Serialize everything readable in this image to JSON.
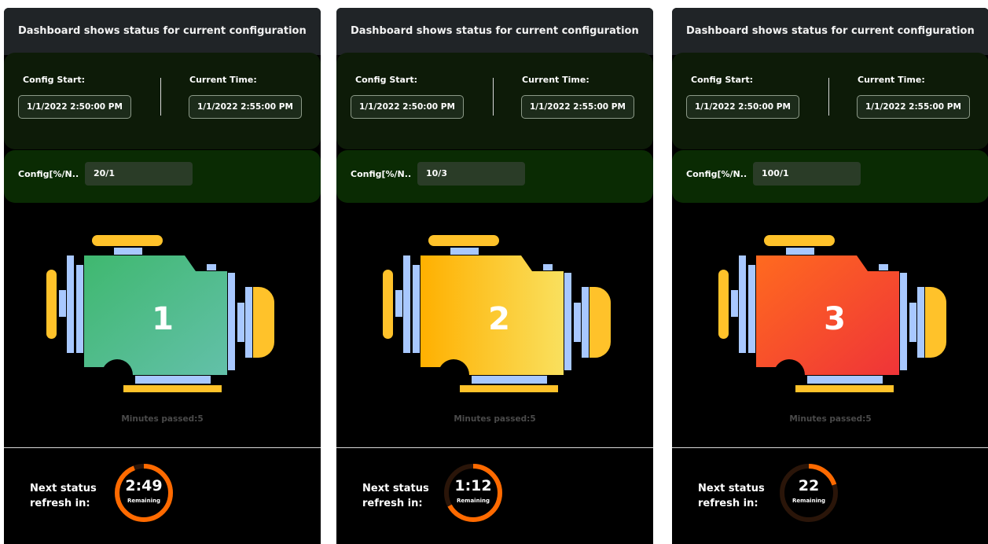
{
  "colors": {
    "accent_orange": "#ff6a00",
    "ring_track": "#2a1509",
    "panel_bg": "#000000",
    "header_bg": "#202427",
    "time_box_bg": "#0d1b08",
    "config_box_bg": "#0a2b03"
  },
  "panels": [
    {
      "title": "Dashboard shows status for current configuration",
      "config_start_label": "Config Start:",
      "config_start_value": "1/1/2022 2:50:00 PM",
      "current_time_label": "Current Time:",
      "current_time_value": "1/1/2022 2:55:00 PM",
      "config_label": "Config[%/N..",
      "config_value": "20/1",
      "engine_number": "1",
      "engine_color_a": "#3fb86f",
      "engine_color_b": "#63c0a9",
      "minutes_passed": "Minutes passed:5",
      "refresh_label_line1": "Next status",
      "refresh_label_line2": "refresh in:",
      "remaining_time": "2:49",
      "remaining_label": "Remaining",
      "remaining_fraction": 0.94
    },
    {
      "title": "Dashboard shows status for current configuration",
      "config_start_label": "Config Start:",
      "config_start_value": "1/1/2022 2:50:00 PM",
      "current_time_label": "Current Time:",
      "current_time_value": "1/1/2022 2:55:00 PM",
      "config_label": "Config[%/N..",
      "config_value": "10/3",
      "engine_number": "2",
      "engine_color_a": "#ffb000",
      "engine_color_b": "#f9e05e",
      "minutes_passed": "Minutes passed:5",
      "refresh_label_line1": "Next status",
      "refresh_label_line2": "refresh in:",
      "remaining_time": "1:12",
      "remaining_label": "Remaining",
      "remaining_fraction": 0.67
    },
    {
      "title": "Dashboard shows status for current configuration",
      "config_start_label": "Config Start:",
      "config_start_value": "1/1/2022 2:50:00 PM",
      "current_time_label": "Current Time:",
      "current_time_value": "1/1/2022 2:55:00 PM",
      "config_label": "Config[%/N..",
      "config_value": "100/1",
      "engine_number": "3",
      "engine_color_a": "#ff6a1f",
      "engine_color_b": "#ef3438",
      "minutes_passed": "Minutes passed:5",
      "refresh_label_line1": "Next status",
      "refresh_label_line2": "refresh in:",
      "remaining_time": "22",
      "remaining_label": "Remaining",
      "remaining_fraction": 0.2
    }
  ]
}
